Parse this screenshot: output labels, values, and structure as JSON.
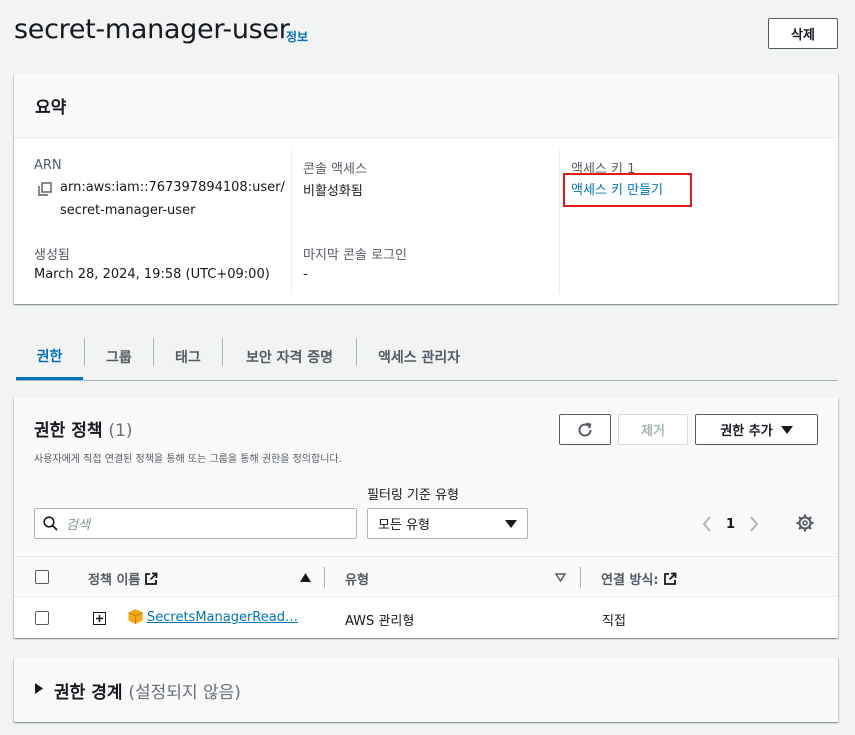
{
  "header": {
    "title": "secret-manager-user",
    "info": "정보",
    "delete_label": "삭제"
  },
  "summary": {
    "title": "요약",
    "arn_label": "ARN",
    "arn_line1": "arn:aws:iam::767397894108:user/",
    "arn_line2": "secret-manager-user",
    "created_label": "생성됨",
    "created_value": "March 28, 2024, 19:58 (UTC+09:00)",
    "console_label": "콘솔 액세스",
    "console_value": "비활성화됨",
    "last_login_label": "마지막 콘솔 로그인",
    "last_login_value": "-",
    "access_key_label": "액세스 키 1",
    "access_key_link": "액세스 키 만들기"
  },
  "tabs": [
    {
      "label": "권한"
    },
    {
      "label": "그룹"
    },
    {
      "label": "태그"
    },
    {
      "label": "보안 자격 증명"
    },
    {
      "label": "액세스 관리자"
    }
  ],
  "permissions": {
    "title": "권한 정책",
    "count": "(1)",
    "description": "사용자에게 직접 연결된 정책을 통해 또는 그룹을 통해 권한을 정의합니다.",
    "remove_label": "제거",
    "add_label": "권한 추가",
    "filter_label": "필터링 기준 유형",
    "search_placeholder": "검색",
    "type_select": "모든 유형",
    "page": "1",
    "columns": {
      "policy_name": "정책 이름",
      "type": "유형",
      "attached_via": "연결 방식:"
    },
    "rows": [
      {
        "policy_name": "SecretsManagerRead…",
        "type": "AWS 관리형",
        "attached_via": "직접"
      }
    ]
  },
  "boundary": {
    "title": "권한 경계",
    "subtitle": "(설정되지 않음)"
  },
  "colors": {
    "link": "#0073bb",
    "highlight": "#e41a1a",
    "policy_icon": "#f7a80d"
  }
}
